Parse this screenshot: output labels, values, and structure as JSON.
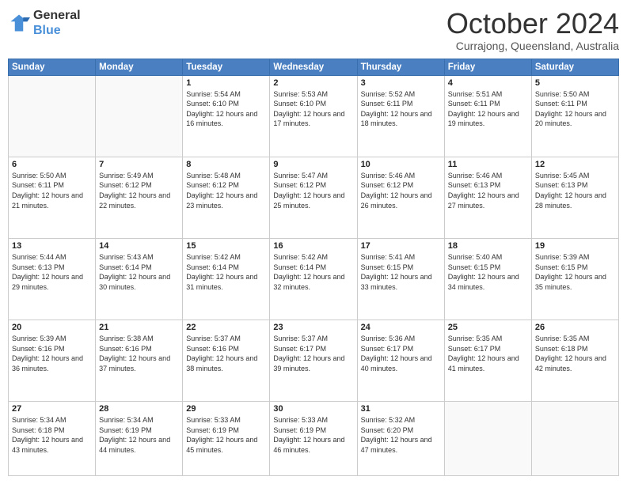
{
  "header": {
    "logo_general": "General",
    "logo_blue": "Blue",
    "month_title": "October 2024",
    "location": "Currajong, Queensland, Australia"
  },
  "weekdays": [
    "Sunday",
    "Monday",
    "Tuesday",
    "Wednesday",
    "Thursday",
    "Friday",
    "Saturday"
  ],
  "weeks": [
    [
      {
        "day": "",
        "info": ""
      },
      {
        "day": "",
        "info": ""
      },
      {
        "day": "1",
        "info": "Sunrise: 5:54 AM\nSunset: 6:10 PM\nDaylight: 12 hours and 16 minutes."
      },
      {
        "day": "2",
        "info": "Sunrise: 5:53 AM\nSunset: 6:10 PM\nDaylight: 12 hours and 17 minutes."
      },
      {
        "day": "3",
        "info": "Sunrise: 5:52 AM\nSunset: 6:11 PM\nDaylight: 12 hours and 18 minutes."
      },
      {
        "day": "4",
        "info": "Sunrise: 5:51 AM\nSunset: 6:11 PM\nDaylight: 12 hours and 19 minutes."
      },
      {
        "day": "5",
        "info": "Sunrise: 5:50 AM\nSunset: 6:11 PM\nDaylight: 12 hours and 20 minutes."
      }
    ],
    [
      {
        "day": "6",
        "info": "Sunrise: 5:50 AM\nSunset: 6:11 PM\nDaylight: 12 hours and 21 minutes."
      },
      {
        "day": "7",
        "info": "Sunrise: 5:49 AM\nSunset: 6:12 PM\nDaylight: 12 hours and 22 minutes."
      },
      {
        "day": "8",
        "info": "Sunrise: 5:48 AM\nSunset: 6:12 PM\nDaylight: 12 hours and 23 minutes."
      },
      {
        "day": "9",
        "info": "Sunrise: 5:47 AM\nSunset: 6:12 PM\nDaylight: 12 hours and 25 minutes."
      },
      {
        "day": "10",
        "info": "Sunrise: 5:46 AM\nSunset: 6:12 PM\nDaylight: 12 hours and 26 minutes."
      },
      {
        "day": "11",
        "info": "Sunrise: 5:46 AM\nSunset: 6:13 PM\nDaylight: 12 hours and 27 minutes."
      },
      {
        "day": "12",
        "info": "Sunrise: 5:45 AM\nSunset: 6:13 PM\nDaylight: 12 hours and 28 minutes."
      }
    ],
    [
      {
        "day": "13",
        "info": "Sunrise: 5:44 AM\nSunset: 6:13 PM\nDaylight: 12 hours and 29 minutes."
      },
      {
        "day": "14",
        "info": "Sunrise: 5:43 AM\nSunset: 6:14 PM\nDaylight: 12 hours and 30 minutes."
      },
      {
        "day": "15",
        "info": "Sunrise: 5:42 AM\nSunset: 6:14 PM\nDaylight: 12 hours and 31 minutes."
      },
      {
        "day": "16",
        "info": "Sunrise: 5:42 AM\nSunset: 6:14 PM\nDaylight: 12 hours and 32 minutes."
      },
      {
        "day": "17",
        "info": "Sunrise: 5:41 AM\nSunset: 6:15 PM\nDaylight: 12 hours and 33 minutes."
      },
      {
        "day": "18",
        "info": "Sunrise: 5:40 AM\nSunset: 6:15 PM\nDaylight: 12 hours and 34 minutes."
      },
      {
        "day": "19",
        "info": "Sunrise: 5:39 AM\nSunset: 6:15 PM\nDaylight: 12 hours and 35 minutes."
      }
    ],
    [
      {
        "day": "20",
        "info": "Sunrise: 5:39 AM\nSunset: 6:16 PM\nDaylight: 12 hours and 36 minutes."
      },
      {
        "day": "21",
        "info": "Sunrise: 5:38 AM\nSunset: 6:16 PM\nDaylight: 12 hours and 37 minutes."
      },
      {
        "day": "22",
        "info": "Sunrise: 5:37 AM\nSunset: 6:16 PM\nDaylight: 12 hours and 38 minutes."
      },
      {
        "day": "23",
        "info": "Sunrise: 5:37 AM\nSunset: 6:17 PM\nDaylight: 12 hours and 39 minutes."
      },
      {
        "day": "24",
        "info": "Sunrise: 5:36 AM\nSunset: 6:17 PM\nDaylight: 12 hours and 40 minutes."
      },
      {
        "day": "25",
        "info": "Sunrise: 5:35 AM\nSunset: 6:17 PM\nDaylight: 12 hours and 41 minutes."
      },
      {
        "day": "26",
        "info": "Sunrise: 5:35 AM\nSunset: 6:18 PM\nDaylight: 12 hours and 42 minutes."
      }
    ],
    [
      {
        "day": "27",
        "info": "Sunrise: 5:34 AM\nSunset: 6:18 PM\nDaylight: 12 hours and 43 minutes."
      },
      {
        "day": "28",
        "info": "Sunrise: 5:34 AM\nSunset: 6:19 PM\nDaylight: 12 hours and 44 minutes."
      },
      {
        "day": "29",
        "info": "Sunrise: 5:33 AM\nSunset: 6:19 PM\nDaylight: 12 hours and 45 minutes."
      },
      {
        "day": "30",
        "info": "Sunrise: 5:33 AM\nSunset: 6:19 PM\nDaylight: 12 hours and 46 minutes."
      },
      {
        "day": "31",
        "info": "Sunrise: 5:32 AM\nSunset: 6:20 PM\nDaylight: 12 hours and 47 minutes."
      },
      {
        "day": "",
        "info": ""
      },
      {
        "day": "",
        "info": ""
      }
    ]
  ]
}
